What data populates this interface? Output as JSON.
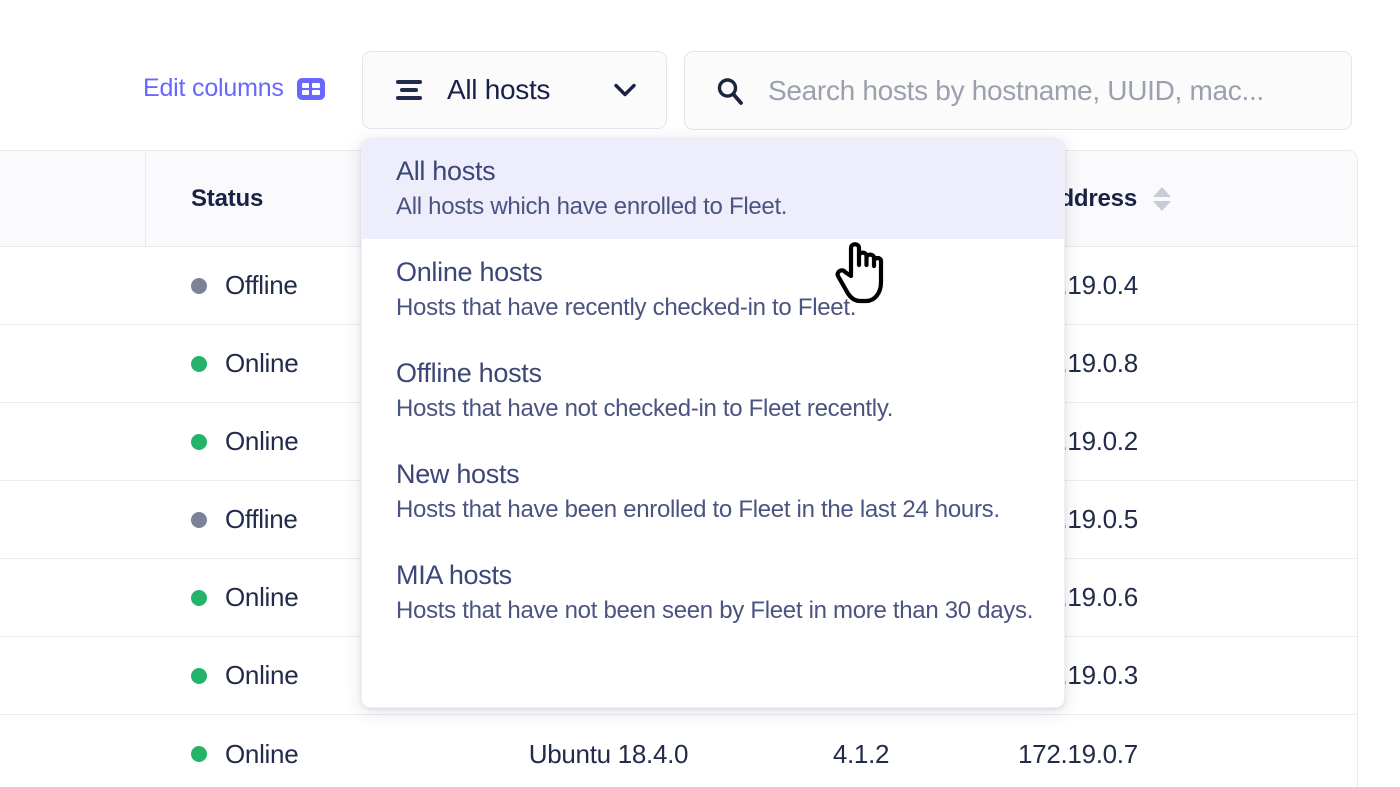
{
  "toolbar": {
    "edit_columns_label": "Edit columns",
    "edit_columns_icon": "table-columns-icon",
    "filter_icon": "hamburger-icon",
    "filter_label": "All hosts",
    "filter_chevron_icon": "chevron-down-icon",
    "search_icon": "search-icon",
    "search_placeholder": "Search hosts by hostname, UUID, mac...",
    "search_value": ""
  },
  "dropdown": {
    "open": true,
    "items": [
      {
        "title": "All hosts",
        "desc": "All hosts which have enrolled to Fleet.",
        "selected": true
      },
      {
        "title": "Online hosts",
        "desc": "Hosts that have recently checked-in to Fleet.",
        "selected": false
      },
      {
        "title": "Offline hosts",
        "desc": "Hosts that have not checked-in to Fleet recently.",
        "selected": false
      },
      {
        "title": "New hosts",
        "desc": "Hosts that have been enrolled to Fleet in the last 24 hours.",
        "selected": false
      },
      {
        "title": "MIA hosts",
        "desc": "Hosts that have not been seen by Fleet in more than 30 days.",
        "selected": false
      }
    ]
  },
  "table": {
    "columns": [
      {
        "key": "c0",
        "label": ""
      },
      {
        "key": "c1",
        "label": "Status"
      },
      {
        "key": "c2",
        "label": ""
      },
      {
        "key": "c3",
        "label": ""
      },
      {
        "key": "c4",
        "label": "IP address",
        "sortable": true,
        "sort_icon": "sort-arrows-icon"
      }
    ],
    "rows": [
      {
        "status": "Offline",
        "status_color": "#7e8296",
        "os": "",
        "version": "",
        "ip": "172.19.0.4"
      },
      {
        "status": "Online",
        "status_color": "#25b36a",
        "os": "",
        "version": "",
        "ip": "172.19.0.8"
      },
      {
        "status": "Online",
        "status_color": "#25b36a",
        "os": "",
        "version": "",
        "ip": "172.19.0.2"
      },
      {
        "status": "Offline",
        "status_color": "#7e8296",
        "os": "",
        "version": "",
        "ip": "172.19.0.5"
      },
      {
        "status": "Online",
        "status_color": "#25b36a",
        "os": "",
        "version": "",
        "ip": "172.19.0.6"
      },
      {
        "status": "Online",
        "status_color": "#25b36a",
        "os": "",
        "version": "",
        "ip": "172.19.0.3"
      },
      {
        "status": "Online",
        "status_color": "#25b36a",
        "os": "Ubuntu 18.4.0",
        "version": "4.1.2",
        "ip": "172.19.0.7"
      }
    ]
  },
  "colors": {
    "accent": "#6a67fe",
    "selected_row_bg": "#eeedfb",
    "online": "#25b36a",
    "offline": "#7e8296",
    "text_dark": "#192147"
  },
  "cursor": {
    "icon": "pointing-hand-cursor"
  }
}
